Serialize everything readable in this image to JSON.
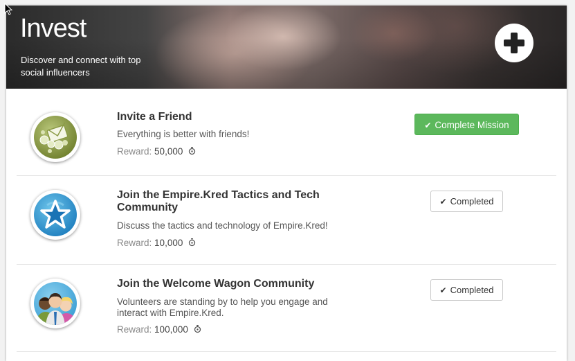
{
  "header": {
    "title": "Invest",
    "subtitle": "Discover and connect with top social influencers"
  },
  "missions": [
    {
      "title": "Invite a Friend",
      "description": "Everything is better with friends!",
      "reward_label": "Reward:",
      "reward_value": "50,000",
      "action_label": "Complete Mission",
      "action_state": "available",
      "badge_icon": "envelope-icon"
    },
    {
      "title": "Join the Empire.Kred Tactics and Tech Community",
      "description": "Discuss the tactics and technology of Empire.Kred!",
      "reward_label": "Reward:",
      "reward_value": "10,000",
      "action_label": "Completed",
      "action_state": "completed",
      "badge_icon": "star-icon"
    },
    {
      "title": "Join the Welcome Wagon Community",
      "description": "Volunteers are standing by to help you engage and interact with Empire.Kred.",
      "reward_label": "Reward:",
      "reward_value": "100,000",
      "action_label": "Completed",
      "action_state": "completed",
      "badge_icon": "people-icon"
    }
  ],
  "colors": {
    "success_green": "#5cb85c",
    "text_dark": "#333333",
    "text_muted": "#888888"
  }
}
